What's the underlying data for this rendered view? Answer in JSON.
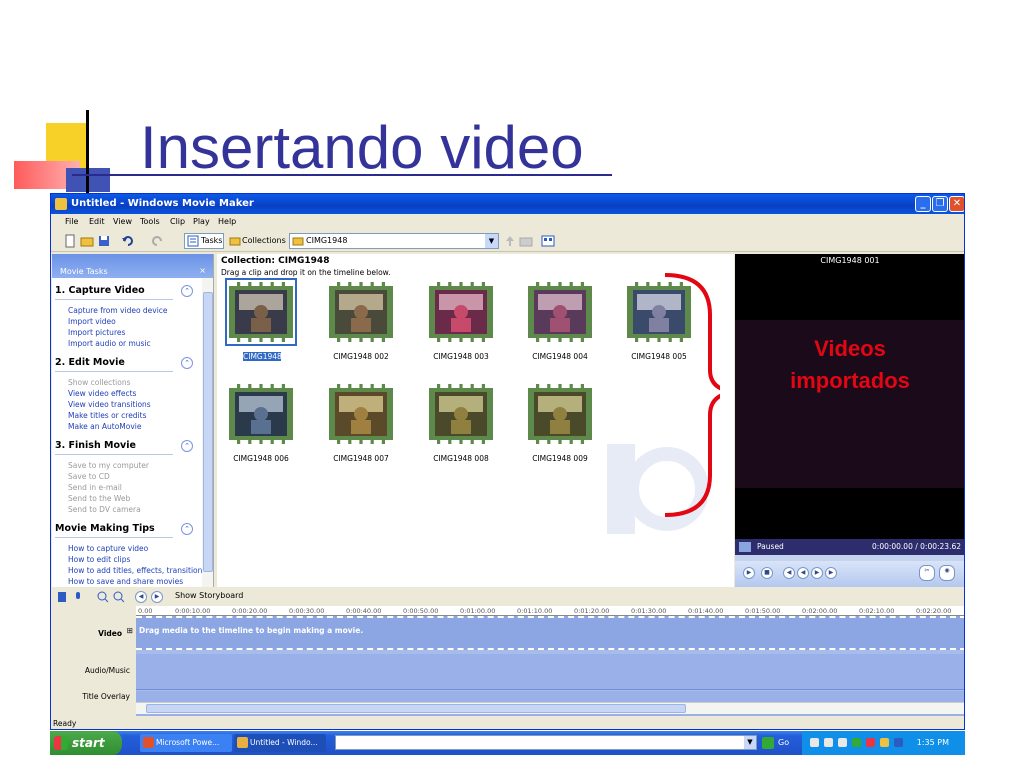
{
  "slide": {
    "title": "Insertando video",
    "annotation_line1": "Videos",
    "annotation_line2": "importados"
  },
  "window": {
    "title": "Untitled - Windows Movie Maker",
    "controls": {
      "minimize": "_",
      "maximize": "❐",
      "close": "✕"
    }
  },
  "menu": [
    "File",
    "Edit",
    "View",
    "Tools",
    "Clip",
    "Play",
    "Help"
  ],
  "toolbar": {
    "tasks_label": "Tasks",
    "collections_label": "Collections",
    "collection_value": "CIMG1948"
  },
  "tasks_pane": {
    "header": "Movie Tasks",
    "close": "×",
    "sections": [
      {
        "title": "1. Capture Video",
        "links": [
          {
            "label": "Capture from video device",
            "enabled": true
          },
          {
            "label": "Import video",
            "enabled": true
          },
          {
            "label": "Import pictures",
            "enabled": true
          },
          {
            "label": "Import audio or music",
            "enabled": true
          }
        ]
      },
      {
        "title": "2. Edit Movie",
        "links": [
          {
            "label": "Show collections",
            "enabled": false
          },
          {
            "label": "View video effects",
            "enabled": true
          },
          {
            "label": "View video transitions",
            "enabled": true
          },
          {
            "label": "Make titles or credits",
            "enabled": true
          },
          {
            "label": "Make an AutoMovie",
            "enabled": true
          }
        ]
      },
      {
        "title": "3. Finish Movie",
        "links": [
          {
            "label": "Save to my computer",
            "enabled": false
          },
          {
            "label": "Save to CD",
            "enabled": false
          },
          {
            "label": "Send in e-mail",
            "enabled": false
          },
          {
            "label": "Send to the Web",
            "enabled": false
          },
          {
            "label": "Send to DV camera",
            "enabled": false
          }
        ]
      },
      {
        "title": "Movie Making Tips",
        "links": [
          {
            "label": "How to capture video",
            "enabled": true
          },
          {
            "label": "How to edit clips",
            "enabled": true
          },
          {
            "label": "How to add titles, effects, transitions",
            "enabled": true
          },
          {
            "label": "How to save and share movies",
            "enabled": true
          }
        ]
      }
    ]
  },
  "collection": {
    "title": "Collection: CIMG1948",
    "subtitle": "Drag a clip and drop it on the timeline below.",
    "clips": [
      {
        "label": "CIMG1948",
        "selected": true
      },
      {
        "label": "CIMG1948 002",
        "selected": false
      },
      {
        "label": "CIMG1948 003",
        "selected": false
      },
      {
        "label": "CIMG1948 004",
        "selected": false
      },
      {
        "label": "CIMG1948 005",
        "selected": false
      },
      {
        "label": "CIMG1948 006",
        "selected": false
      },
      {
        "label": "CIMG1948 007",
        "selected": false
      },
      {
        "label": "CIMG1948 008",
        "selected": false
      },
      {
        "label": "CIMG1948 009",
        "selected": false
      }
    ]
  },
  "monitor": {
    "title": "CIMG1948 001",
    "status": "Paused",
    "time": "0:00:00.00 / 0:00:23.62"
  },
  "timeline": {
    "show_storyboard": "Show Storyboard",
    "ruler": [
      "0.00",
      "0:00:10.00",
      "0:00:20.00",
      "0:00:30.00",
      "0:00:40.00",
      "0:00:50.00",
      "0:01:00.00",
      "0:01:10.00",
      "0:01:20.00",
      "0:01:30.00",
      "0:01:40.00",
      "0:01:50.00",
      "0:02:00.00",
      "0:02:10.00",
      "0:02:20.00"
    ],
    "video_label": "Video",
    "expand": "⊞",
    "audio_label": "Audio/Music",
    "title_overlay_label": "Title Overlay",
    "drag_hint": "Drag media to the timeline to begin making a movie."
  },
  "status_bar": "Ready",
  "taskbar": {
    "start": "start",
    "items": [
      "Microsoft Powe...",
      "Untitled - Windo..."
    ],
    "go": "Go",
    "time": "1:35 PM"
  },
  "colors": {
    "slide_title": "#333399",
    "annotation": "#e30613",
    "xp_blue": "#0a5ae8",
    "start_green": "#2f8e2f"
  }
}
